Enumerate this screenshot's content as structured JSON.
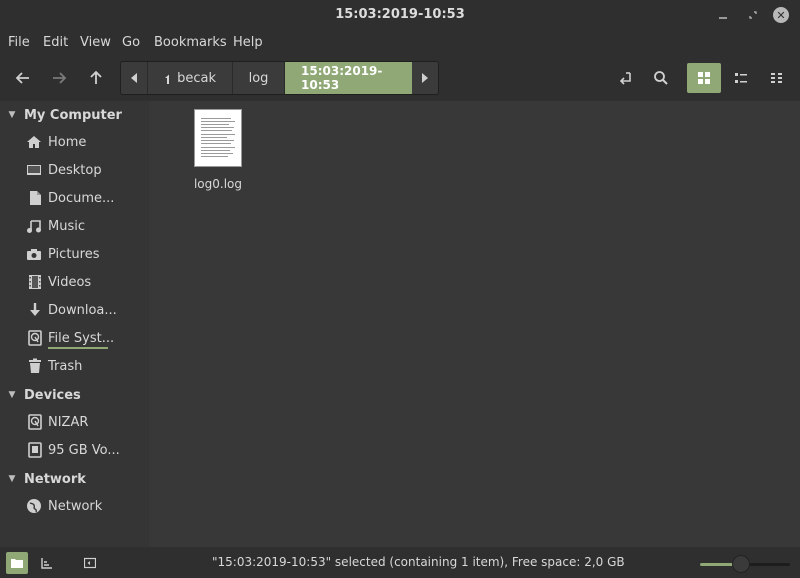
{
  "window": {
    "title": "15:03:2019-10:53"
  },
  "menu": {
    "items": [
      "File",
      "Edit",
      "View",
      "Go",
      "Bookmarks",
      "Help"
    ]
  },
  "toolbar": {
    "back_icon": "arrow-left-icon",
    "forward_icon": "arrow-right-icon",
    "up_icon": "arrow-up-icon",
    "toggle_location_icon": "location-toggle-icon",
    "search_icon": "search-icon",
    "icon_view_icon": "grid-view-icon",
    "list_view_icon": "list-view-icon",
    "compact_view_icon": "compact-view-icon"
  },
  "path": {
    "crumbs": [
      "becak",
      "log",
      "15:03:2019-10:53"
    ]
  },
  "sidebar": {
    "sections": [
      {
        "title": "My Computer",
        "items": [
          "Home",
          "Desktop",
          "Docume...",
          "Music",
          "Pictures",
          "Videos",
          "Downloa...",
          "File Syst...",
          "Trash"
        ]
      },
      {
        "title": "Devices",
        "items": [
          "NIZAR",
          "95 GB Vo..."
        ]
      },
      {
        "title": "Network",
        "items": [
          "Network"
        ]
      }
    ]
  },
  "files": [
    {
      "name": "log0.log",
      "icon": "text-file-icon"
    }
  ],
  "status": {
    "text": "\"15:03:2019-10:53\" selected (containing 1 item), Free space: 2,0 GB",
    "zoom_fraction": 0.45
  },
  "colors": {
    "accent": "#8fa876",
    "background": "#2f2f2f",
    "content": "#383838",
    "sidebar": "#353535"
  }
}
